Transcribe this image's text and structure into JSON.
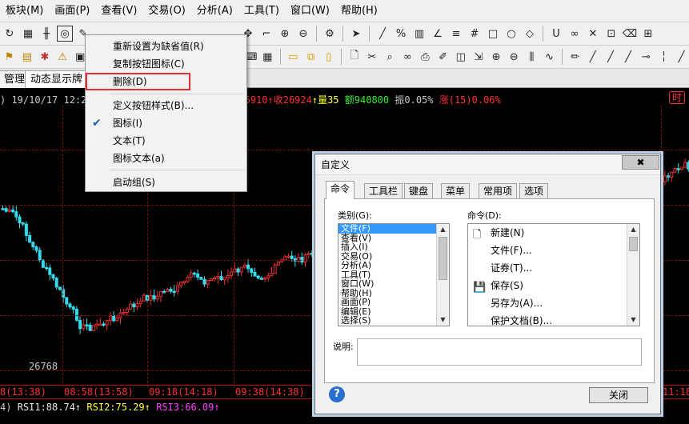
{
  "menubar": [
    "板块(M)",
    "画面(P)",
    "查看(V)",
    "交易(O)",
    "分析(A)",
    "工具(T)",
    "窗口(W)",
    "帮助(H)"
  ],
  "tabs": [
    "管理",
    "动态显示牌"
  ],
  "info_line": {
    "left": ") 19/10/17 12:2",
    "mid": "26910",
    "close_label": "↑收26924",
    "volume": "↑量35",
    "amount": "额940800",
    "amplitude": "振0.05%",
    "change": "涨(15)0.06%"
  },
  "right_tag": "时",
  "time_labels": [
    "8(13:38)",
    "08:58(13:58)",
    "09:18(14:18)",
    "09:38(14:38)",
    "11:18"
  ],
  "low_value": "26768",
  "rsi": {
    "prefix": "4)",
    "rsi1": "RSI1:88.74↑",
    "rsi2": "RSI2:75.29↑",
    "rsi3": "RSI3:66.09↑"
  },
  "context_menu": {
    "items": [
      "重新设置为缺省值(R)",
      "复制按钮图标(C)",
      "删除(D)",
      "定义按钮样式(B)...",
      "图标(I)",
      "文本(T)",
      "图标文本(a)",
      "启动组(S)"
    ],
    "checked": "✔"
  },
  "dialog": {
    "title": "自定义",
    "close": "✖",
    "tabs": [
      "命令",
      "工具栏",
      "键盘",
      "菜单",
      "常用项",
      "选项"
    ],
    "category_label": "类别(G):",
    "command_label": "命令(D):",
    "categories": [
      "文件(F)",
      "查看(V)",
      "插入(I)",
      "交易(O)",
      "分析(A)",
      "工具(T)",
      "窗口(W)",
      "帮助(H)",
      "画面(P)",
      "编辑(E)",
      "选择(S)"
    ],
    "commands": [
      "新建(N)",
      "文件(F)...",
      "证券(T)...",
      "保存(S)",
      "另存为(A)...",
      "保护文档(B)..."
    ],
    "desc_label": "说明:",
    "help": "?",
    "close_button": "关闭"
  },
  "colors": {
    "up": "#e83030",
    "down": "#33ddee",
    "grid": "#7a1010",
    "select": "#3399ff",
    "highlight": "#e03030"
  }
}
